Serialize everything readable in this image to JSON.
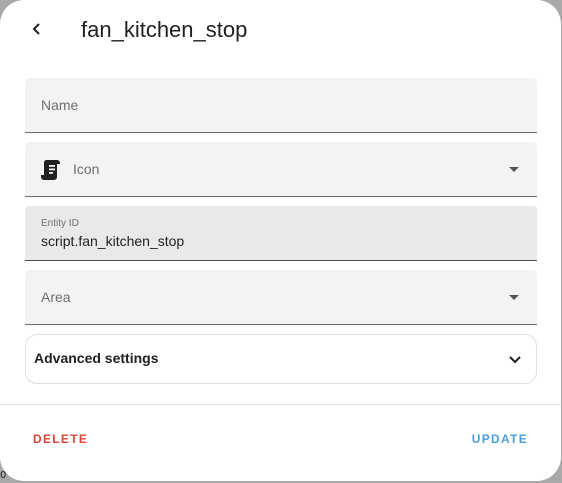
{
  "header": {
    "title": "fan_kitchen_stop"
  },
  "form": {
    "name_field": {
      "label": "Name",
      "value": ""
    },
    "icon_field": {
      "label": "Icon",
      "icon": "script-text-icon"
    },
    "entity_id_field": {
      "label": "Entity ID",
      "value": "script.fan_kitchen_stop"
    },
    "area_field": {
      "label": "Area",
      "value": ""
    },
    "advanced_settings": {
      "label": "Advanced settings"
    }
  },
  "footer": {
    "delete_label": "DELETE",
    "update_label": "UPDATE"
  },
  "corner_text": "0",
  "colors": {
    "delete": "#db4437",
    "update": "#4a9fd8"
  }
}
